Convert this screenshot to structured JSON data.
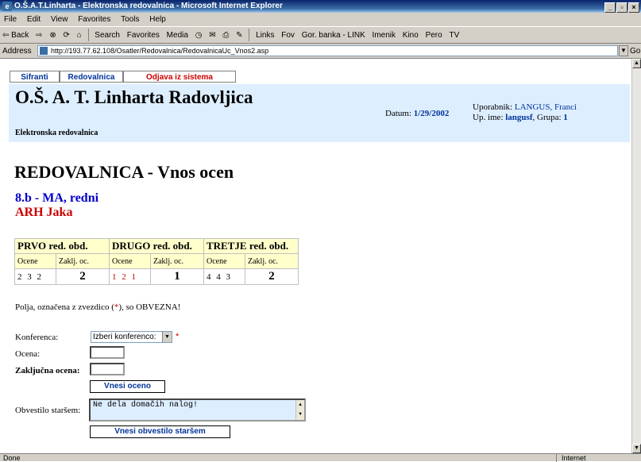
{
  "window": {
    "title": "O.Š.A.T.Linharta - Elektronska redovalnica - Microsoft Internet Explorer",
    "minimize": "_",
    "restore": "▫",
    "close": "×"
  },
  "menu": [
    "File",
    "Edit",
    "View",
    "Favorites",
    "Tools",
    "Help"
  ],
  "toolbar": {
    "back": "⇦ Back",
    "forward": "⇨",
    "search": "Search",
    "favorites": "Favorites",
    "media": "Media",
    "links_label": "Links",
    "links": [
      "Fov",
      "Gor. banka - LINK",
      "Imenik",
      "Kino",
      "Pero",
      "TV"
    ]
  },
  "address": {
    "label": "Address",
    "url": "http://193.77.62.108/Osatler/Redovalnica/RedovalnicaUc_Vnos2.asp",
    "go": "Go"
  },
  "nav": [
    "Sifranti",
    "Redovalnica",
    "Odjava iz sistema"
  ],
  "header": {
    "school": "O.Š. A. T. Linharta Radovljica",
    "subtitle": "Elektronska redovalnica",
    "datum_label": "Datum:",
    "datum_value": "1/29/2002",
    "user_label": "Uporabnik:",
    "user_name": "LANGUS, Franci",
    "upime_label": "Up. ime:",
    "upime_value": "langusf",
    "group_label": "Grupa:",
    "group_value": "1"
  },
  "page": {
    "title": "REDOVALNICA - Vnos ocen",
    "class_line": "8.b - MA, redni",
    "pupil": "ARH Jaka"
  },
  "grades": {
    "periods": [
      "PRVO red. obd.",
      "DRUGO red. obd.",
      "TRETJE red. obd."
    ],
    "col_grades": "Ocene",
    "col_final": "Zaklj. oc.",
    "p1_grades": "2 3 2",
    "p1_final": "2",
    "p2_grades": "1 2 1",
    "p2_final": "1",
    "p3_grades": "4 4 3",
    "p3_final": "2"
  },
  "form": {
    "required_note_pre": "Polja, označena z zvezdico (",
    "required_star": "*",
    "required_note_post": "), so OBVEZNA!",
    "conference_label": "Konferenca:",
    "conference_value": "Izberi konferenco:",
    "grade_label": "Ocena:",
    "final_label": "Zaključna ocena:",
    "submit_grade": "Vnesi oceno",
    "notice_label": "Obvestilo staršem:",
    "notice_value": "Ne dela domačih nalog!",
    "submit_notice": "Vnesi obvestilo staršem"
  },
  "status": {
    "left": "Done",
    "zone": "Internet"
  }
}
